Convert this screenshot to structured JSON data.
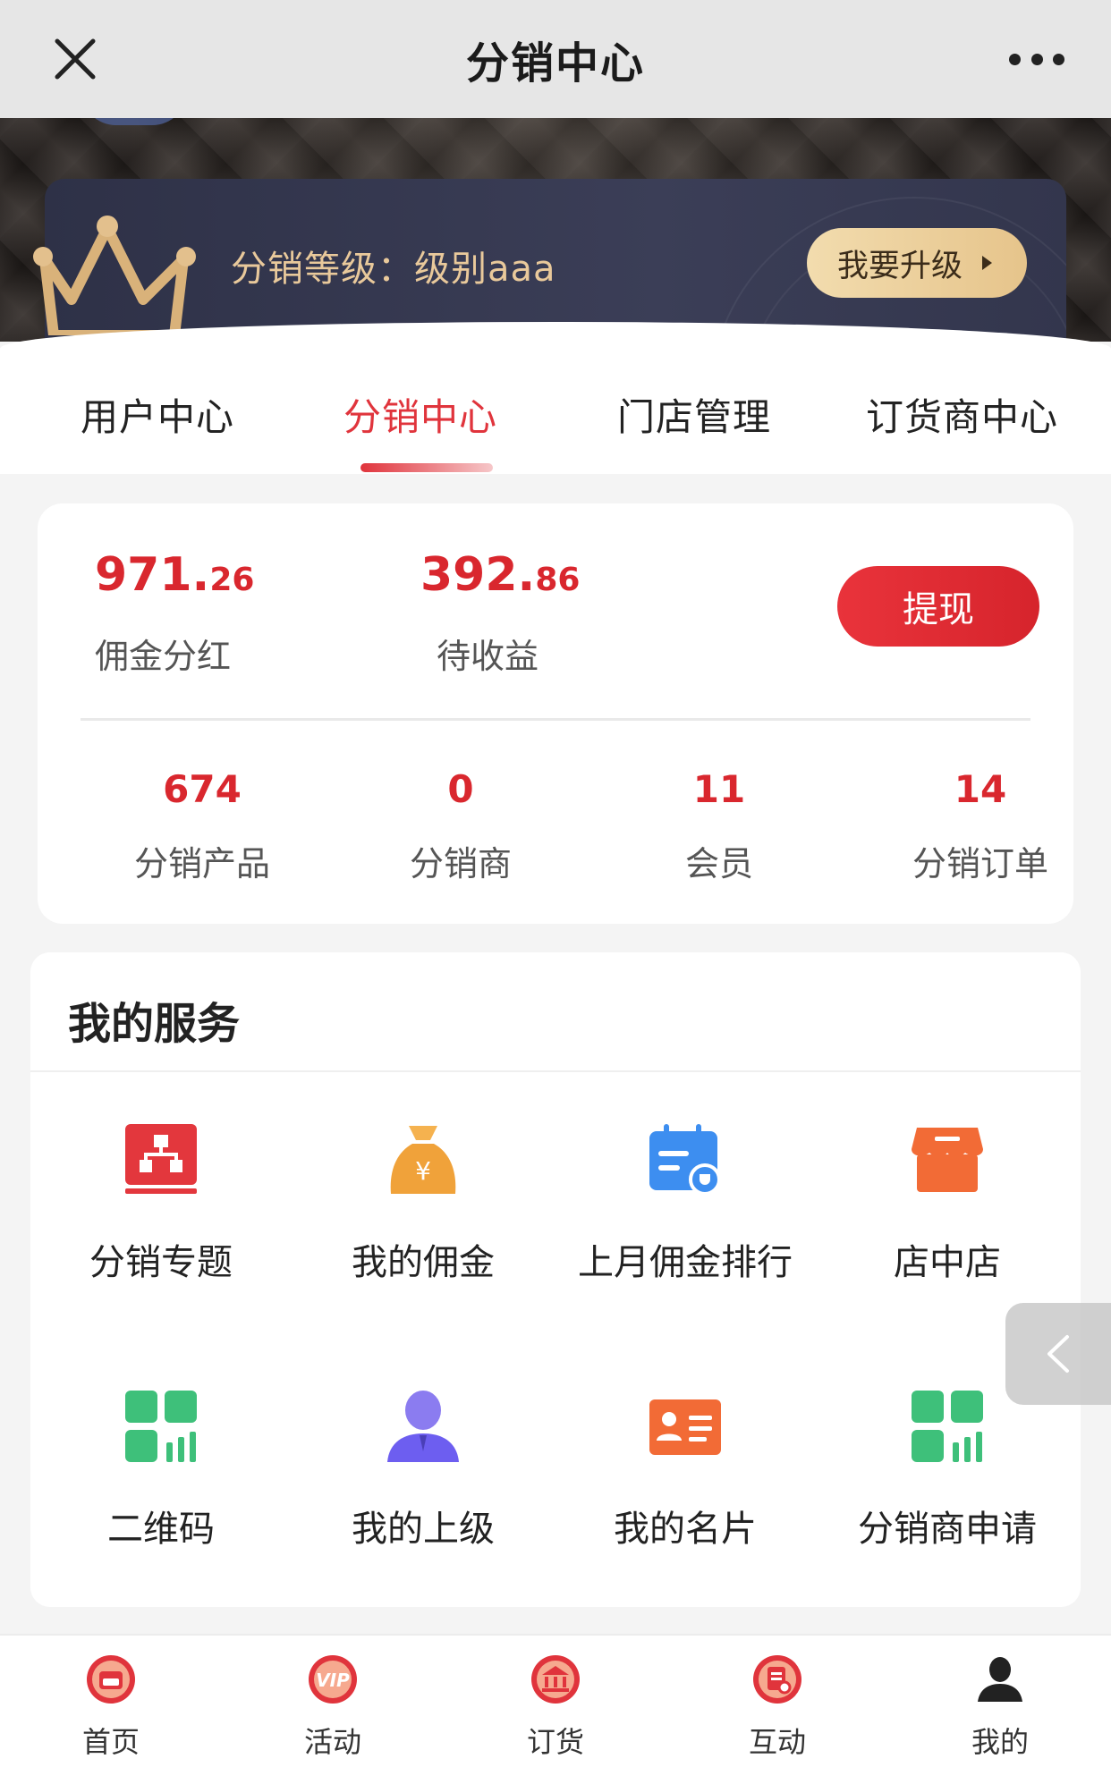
{
  "window": {
    "title": "分销中心"
  },
  "level": {
    "label": "分销等级：级别aaa",
    "upgrade_label": "我要升级"
  },
  "tabs": [
    {
      "label": "用户中心"
    },
    {
      "label": "分销中心"
    },
    {
      "label": "门店管理"
    },
    {
      "label": "订货商中心"
    }
  ],
  "active_tab": 1,
  "earnings": {
    "commission_int": "971.",
    "commission_dec": "26",
    "commission_label": "佣金分红",
    "pending_int": "392.",
    "pending_dec": "86",
    "pending_label": "待收益",
    "withdraw_label": "提现"
  },
  "counts": [
    {
      "value": "674",
      "label": "分销产品"
    },
    {
      "value": "0",
      "label": "分销商"
    },
    {
      "value": "11",
      "label": "会员"
    },
    {
      "value": "14",
      "label": "分销订单"
    }
  ],
  "services": {
    "heading": "我的服务",
    "items": [
      {
        "label": "分销专题",
        "icon": "org-chart-icon"
      },
      {
        "label": "我的佣金",
        "icon": "money-bag-icon"
      },
      {
        "label": "上月佣金排行",
        "icon": "calendar-trophy-icon"
      },
      {
        "label": "店中店",
        "icon": "storefront-icon"
      },
      {
        "label": "二维码",
        "icon": "qrcode-icon"
      },
      {
        "label": "我的上级",
        "icon": "person-icon"
      },
      {
        "label": "我的名片",
        "icon": "business-card-icon"
      },
      {
        "label": "分销商申请",
        "icon": "apply-icon"
      }
    ]
  },
  "bottom_nav": [
    {
      "label": "首页",
      "icon": "home-icon"
    },
    {
      "label": "活动",
      "icon": "vip-icon"
    },
    {
      "label": "订货",
      "icon": "bank-icon"
    },
    {
      "label": "互动",
      "icon": "interact-icon"
    },
    {
      "label": "我的",
      "icon": "user-icon"
    }
  ],
  "colors": {
    "accent": "#d9272e",
    "gold": "#e9c99b",
    "card_dark": "#33364d"
  }
}
